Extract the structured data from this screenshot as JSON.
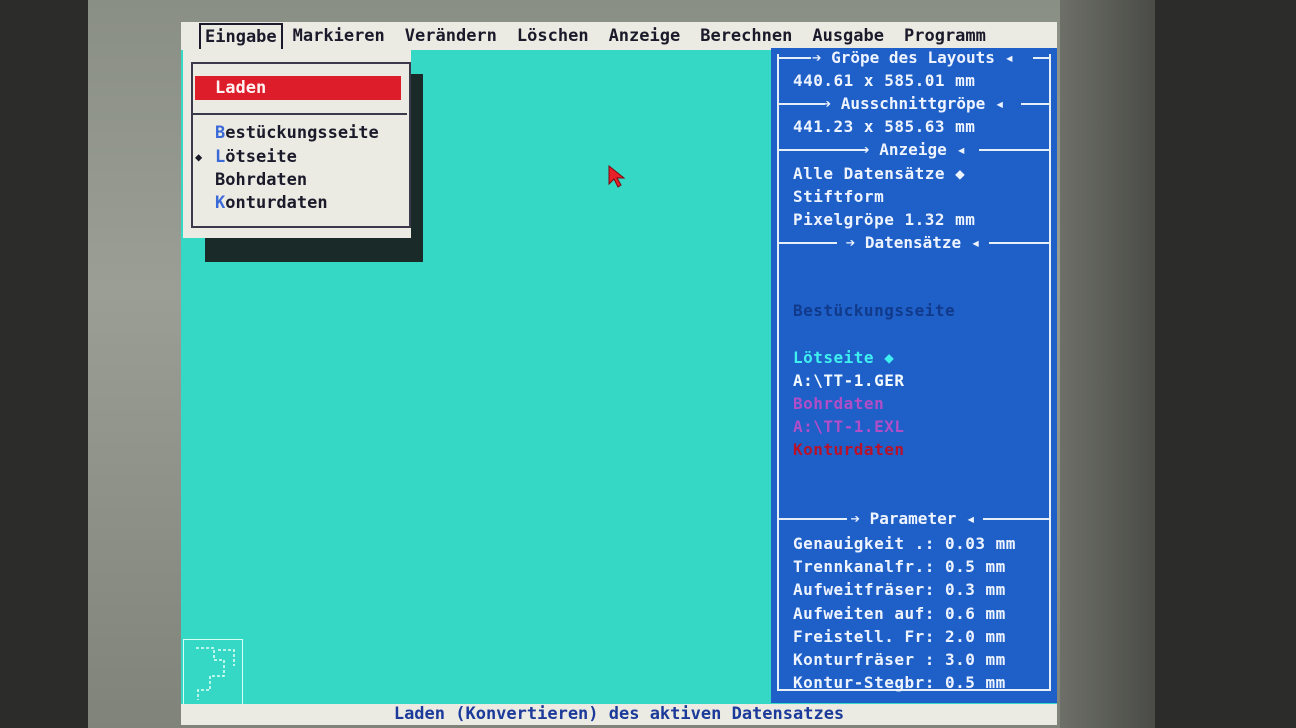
{
  "menu": {
    "items": [
      "Eingabe",
      "Markieren",
      "Verändern",
      "Löschen",
      "Anzeige",
      "Berechnen",
      "Ausgabe",
      "Programm"
    ]
  },
  "dropdown": {
    "selected": "Laden",
    "items": [
      {
        "hot": "B",
        "rest": "estückungsseite",
        "bullet": false
      },
      {
        "hot": "L",
        "rest": "ötseite",
        "bullet": true
      },
      {
        "hot": "B",
        "rest": "ohrdaten",
        "bullet": false
      },
      {
        "hot": "K",
        "rest": "onturdaten",
        "bullet": false
      }
    ]
  },
  "panel": {
    "layout_header": "Gröpe des Layouts",
    "layout_size": "440.61 x 585.01 mm",
    "cutout_header": "Ausschnittgröpe",
    "cutout_size": "441.23 x 585.63 mm",
    "display_header": "Anzeige",
    "display_all": "Alle Datensätze ◆",
    "display_pin": "Stiftform",
    "display_pixel": "Pixelgröpe 1.32 mm",
    "records_header": "Datensätze",
    "rec_bestueck": "Bestückungsseite",
    "rec_loet": "Lötseite ◆",
    "rec_loet_file": "A:\\TT-1.GER",
    "rec_bohr": "Bohrdaten",
    "rec_bohr_file": "A:\\TT-1.EXL",
    "rec_kontur": "Konturdaten",
    "params_header": "Parameter",
    "params": [
      "Genauigkeit .: 0.03 mm",
      "Trennkanalfr.: 0.5 mm",
      "Aufweitfräser: 0.3 mm",
      "Aufweiten auf: 0.6 mm",
      "Freistell. Fr: 2.0 mm",
      "Konturfräser : 3.0 mm",
      "Kontur-Stegbr: 0.5 mm"
    ]
  },
  "status": "Laden (Konvertieren) des aktiven Datensatzes",
  "colors": {
    "workspace": "#35d8c4",
    "panel": "#1f5fc8",
    "selection": "#dd1d2a",
    "menubar": "#ecebe3"
  }
}
